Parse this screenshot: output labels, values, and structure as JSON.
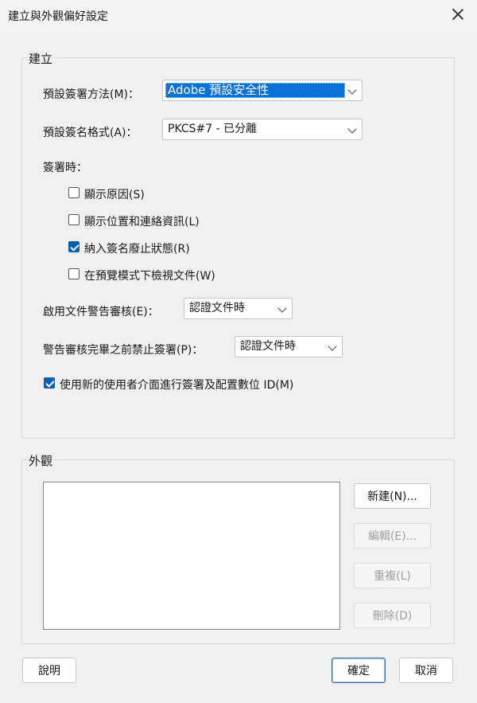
{
  "window": {
    "title": "建立與外觀偏好設定"
  },
  "create": {
    "group_label": "建立",
    "signing_method_label": "預設簽署方法(M)：",
    "signing_method_value": "Adobe 預設安全性",
    "signature_format_label": "預設簽名格式(A)：",
    "signature_format_value": "PKCS#7 - 已分離",
    "when_signing_label": "簽署時：",
    "checkboxes": [
      {
        "label": "顯示原因(S)",
        "checked": false
      },
      {
        "label": "顯示位置和連絡資訊(L)",
        "checked": false
      },
      {
        "label": "納入簽名廢止狀態(R)",
        "checked": true
      },
      {
        "label": "在預覽模式下檢視文件(W)",
        "checked": false
      }
    ],
    "enable_review_label": "啟用文件警告審核(E)：",
    "enable_review_value": "認證文件時",
    "prevent_signing_label": "警告審核完畢之前禁止簽署(P)：",
    "prevent_signing_value": "認證文件時",
    "new_ui_label": "使用新的使用者介面進行簽署及配置數位 ID(M)",
    "new_ui_checked": true
  },
  "appearance": {
    "group_label": "外觀",
    "new_button": "新建(N)...",
    "edit_button": "編輯(E)...",
    "duplicate_button": "重複(L)",
    "delete_button": "刪除(D)"
  },
  "footer": {
    "help_button": "說明",
    "ok_button": "確定",
    "cancel_button": "取消"
  },
  "colors": {
    "accent": "#0a72d6",
    "checkbox_checked": "#0a5fb4"
  }
}
